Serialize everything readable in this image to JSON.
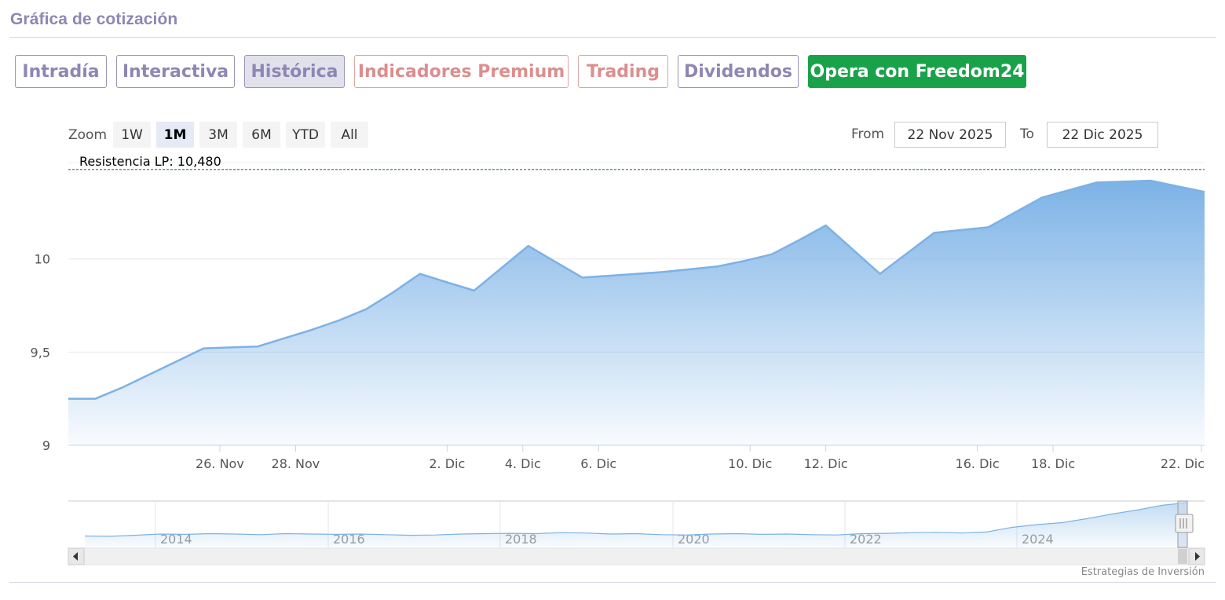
{
  "section": {
    "title": "Gráfica de cotización"
  },
  "tabs": [
    {
      "label": "Intradía",
      "style": "normal"
    },
    {
      "label": "Interactiva",
      "style": "normal"
    },
    {
      "label": "Histórica",
      "style": "active"
    },
    {
      "label": "Indicadores Premium",
      "style": "premium"
    },
    {
      "label": "Trading",
      "style": "premium"
    },
    {
      "label": "Dividendos",
      "style": "normal"
    },
    {
      "label": "Opera con Freedom24",
      "style": "cta"
    }
  ],
  "zoom": {
    "label": "Zoom",
    "buttons": [
      "1W",
      "1M",
      "3M",
      "6M",
      "YTD",
      "All"
    ],
    "selected": "1M"
  },
  "range": {
    "from_label": "From",
    "from_value": "22 Nov 2025",
    "to_label": "To",
    "to_value": "22 Dic 2025"
  },
  "credit": "Estrategias de Inversión",
  "colors": {
    "line": "#7cb2e6",
    "area_top": "#7cb2e6",
    "resistance": "#2e7d32",
    "cta": "#1aa24a",
    "tab_text": "#8e86b4"
  },
  "chart_data": {
    "type": "area",
    "x": [
      "2025-11-22",
      "2025-11-23",
      "2025-11-24",
      "2025-11-25",
      "2025-11-26",
      "2025-11-27",
      "2025-11-28",
      "2025-11-29",
      "2025-11-30",
      "2025-12-01",
      "2025-12-02",
      "2025-12-03",
      "2025-12-04",
      "2025-12-05",
      "2025-12-06",
      "2025-12-07",
      "2025-12-08",
      "2025-12-09",
      "2025-12-10",
      "2025-12-11",
      "2025-12-12",
      "2025-12-13",
      "2025-12-14",
      "2025-12-15",
      "2025-12-16",
      "2025-12-17",
      "2025-12-18",
      "2025-12-19",
      "2025-12-20",
      "2025-12-21",
      "2025-12-22"
    ],
    "y": [
      9.25,
      9.25,
      9.31,
      9.38,
      9.45,
      9.52,
      9.525,
      9.53,
      9.575,
      9.62,
      9.67,
      9.73,
      9.82,
      9.92,
      9.875,
      9.83,
      9.95,
      10.07,
      9.985,
      9.9,
      9.91,
      9.92,
      9.93,
      9.945,
      9.96,
      9.99,
      10.025,
      10.1,
      10.18,
      10.05,
      9.92,
      10.03,
      10.14,
      10.155,
      10.17,
      10.25,
      10.33,
      10.37,
      10.41,
      10.415,
      10.42,
      10.39,
      10.36
    ],
    "xticks": [
      "26. Nov",
      "28. Nov",
      "2. Dic",
      "4. Dic",
      "6. Dic",
      "10. Dic",
      "12. Dic",
      "16. Dic",
      "18. Dic",
      "22. Dic"
    ],
    "yticks": [
      "9",
      "9,5",
      "10"
    ],
    "ylim": [
      9,
      10.5
    ],
    "annotations": [
      {
        "label": "Resistencia LP: 10,480",
        "value": 10.48
      }
    ],
    "navigator": {
      "years": [
        "2014",
        "2016",
        "2018",
        "2020",
        "2022",
        "2024"
      ],
      "series": [
        1.0,
        0.95,
        1.1,
        1.3,
        1.25,
        1.35,
        1.3,
        1.2,
        1.35,
        1.3,
        1.25,
        1.3,
        1.2,
        1.1,
        1.15,
        1.3,
        1.35,
        1.4,
        1.35,
        1.5,
        1.45,
        1.3,
        1.35,
        1.2,
        1.15,
        1.3,
        1.35,
        1.25,
        1.3,
        1.2,
        1.15,
        1.35,
        1.4,
        1.5,
        1.55,
        1.45,
        1.6,
        2.3,
        2.7,
        3.0,
        3.6,
        4.3,
        4.9,
        5.6,
        6.0
      ]
    }
  }
}
